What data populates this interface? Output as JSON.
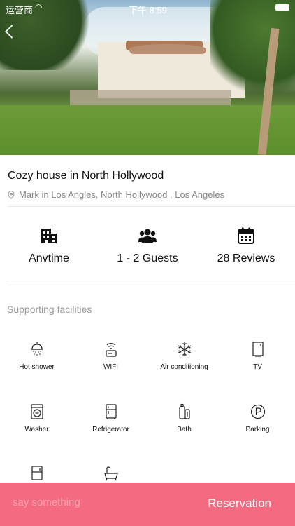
{
  "status_bar": {
    "carrier": "运营商",
    "time": "下午 8:59"
  },
  "listing": {
    "title": "Cozy house in North Hollywood",
    "location": "Mark in Los Angles, North Hollywood , Los Angeles"
  },
  "stats": [
    {
      "label": "Anvtime",
      "icon": "building-icon"
    },
    {
      "label": "1 - 2 Guests",
      "icon": "users-icon"
    },
    {
      "label": "28 Reviews",
      "icon": "calendar-icon"
    }
  ],
  "facilities": {
    "title": "Supporting facilities",
    "items": [
      {
        "label": "Hot shower",
        "icon": "shower-icon"
      },
      {
        "label": "WIFI",
        "icon": "wifi-router-icon"
      },
      {
        "label": "Air conditioning",
        "icon": "snowflake-icon"
      },
      {
        "label": "TV",
        "icon": "tv-icon"
      },
      {
        "label": "Washer",
        "icon": "washer-icon"
      },
      {
        "label": "Refrigerator",
        "icon": "refrigerator-icon"
      },
      {
        "label": "Bath",
        "icon": "bath-bottles-icon"
      },
      {
        "label": "Parking",
        "icon": "parking-icon"
      },
      {
        "label": "",
        "icon": "fridge-icon"
      },
      {
        "label": "",
        "icon": "bathtub-icon"
      }
    ]
  },
  "bottom_bar": {
    "input_placeholder": "say something",
    "reserve_label": "Reservation",
    "accent": "#f46b81"
  }
}
